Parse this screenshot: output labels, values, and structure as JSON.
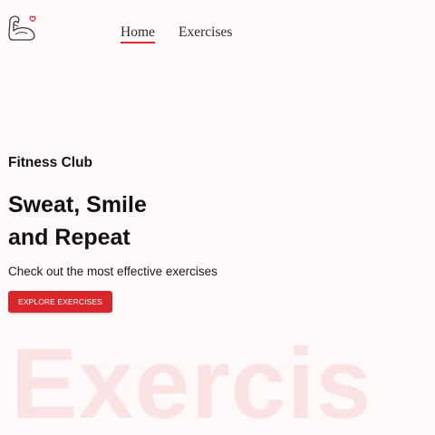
{
  "nav": {
    "logo_icon": "flexed-arm-heart-icon",
    "links": [
      {
        "label": "Home",
        "active": true
      },
      {
        "label": "Exercises",
        "active": false
      }
    ],
    "accent_color": "#e0282e"
  },
  "hero": {
    "eyebrow": "Fitness Club",
    "headline_line1": "Sweat, Smile",
    "headline_line2": "and Repeat",
    "subtitle": "Check out the most effective exercises",
    "cta_label": "EXPLORE EXERCISES",
    "cta_color": "#d9262c"
  },
  "watermark": {
    "text": "Exercis",
    "color": "#fce3e3"
  }
}
